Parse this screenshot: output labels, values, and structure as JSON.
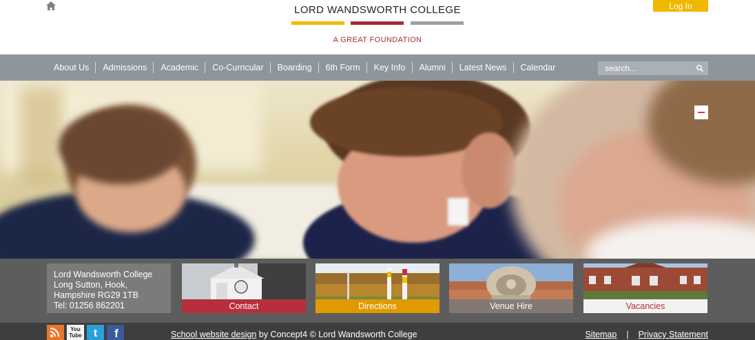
{
  "header": {
    "home_icon": "home-icon",
    "logo_title": "LORD WANDSWORTH COLLEGE",
    "logo_tagline": "A GREAT FOUNDATION",
    "login_label": "Log In",
    "colors": {
      "bar_yellow": "#f0b800",
      "bar_red": "#a52a36",
      "bar_grey": "#9aa0a6",
      "login": "#f0b800"
    }
  },
  "nav": {
    "items": [
      "About Us",
      "Admissions",
      "Academic",
      "Co-Curricular",
      "Boarding",
      "6th Form",
      "Key Info",
      "Alumni",
      "Latest News",
      "Calendar"
    ],
    "search": {
      "placeholder": "search...",
      "icon": "search-icon"
    },
    "background": "#8e959b"
  },
  "hero": {
    "collapse_icon": "minus-icon"
  },
  "address": {
    "lines": [
      "Lord Wandsworth College",
      "Long Sutton, Hook,",
      "Hampshire RG29 1TB",
      "Tel: 01256 862201"
    ]
  },
  "tiles": [
    {
      "label": "Contact",
      "color": "#b5303c"
    },
    {
      "label": "Directions",
      "color": "#e09a00"
    },
    {
      "label": "Venue Hire",
      "color": "#8b8b8b"
    },
    {
      "label": "Vacancies",
      "color": "#f2f2f2"
    }
  ],
  "footer": {
    "social": [
      "rss-icon",
      "youtube-icon",
      "twitter-icon",
      "facebook-icon"
    ],
    "youtube_text": "You Tube",
    "design_link": "School website design",
    "credit_text": " by Concept4 © Lord Wandsworth College",
    "sitemap": "Sitemap",
    "separator": "|",
    "privacy": "Privacy Statement"
  }
}
